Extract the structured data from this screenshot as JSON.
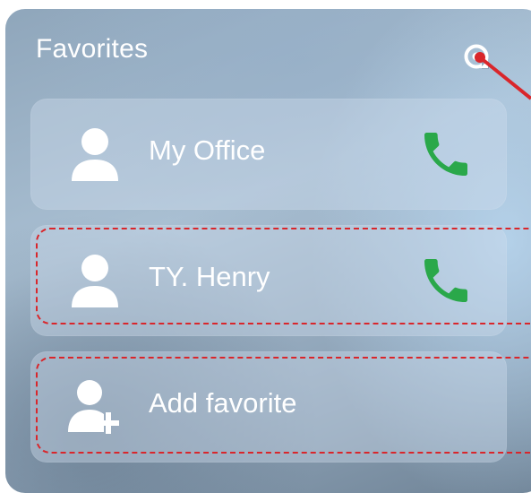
{
  "widget": {
    "title": "Favorites",
    "settings_icon": "settings-icon"
  },
  "favorites": [
    {
      "name": "My Office",
      "icon": "person-icon",
      "action_icon": "phone-icon"
    },
    {
      "name": "TY. Henry",
      "icon": "person-icon",
      "action_icon": "phone-icon"
    }
  ],
  "add_favorite": {
    "label": "Add favorite",
    "icon": "add-person-icon"
  },
  "colors": {
    "call_green": "#2aa84a",
    "annotation_red": "#d9262b",
    "text": "#ffffff"
  }
}
